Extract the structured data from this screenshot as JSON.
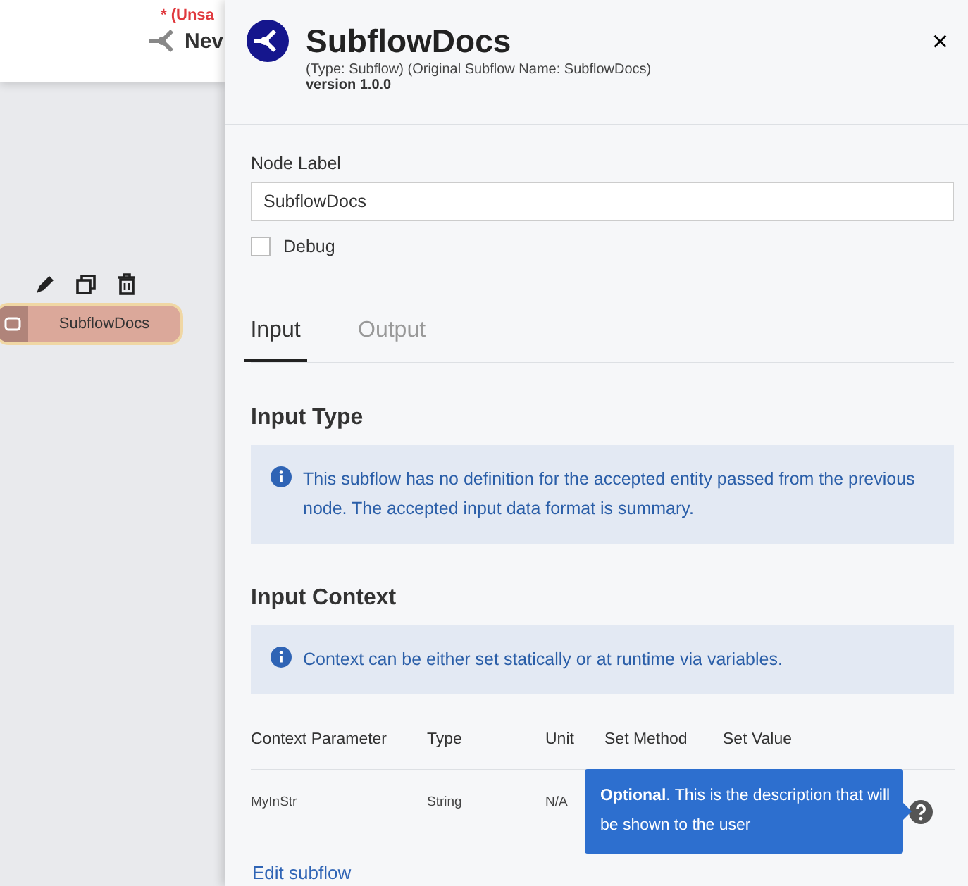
{
  "canvas": {
    "unsaved": "* (Unsa",
    "flow_name": "Nev",
    "node": {
      "label": "SubflowDocs",
      "selected": true
    }
  },
  "panel": {
    "title": "SubflowDocs",
    "subtitle": "(Type: Subflow) (Original Subflow Name: SubflowDocs)",
    "version": "version 1.0.0",
    "close": "×",
    "node_label": {
      "label": "Node Label",
      "value": "SubflowDocs"
    },
    "debug": {
      "label": "Debug",
      "checked": false
    },
    "tabs": [
      {
        "label": "Input",
        "selected": true
      },
      {
        "label": "Output",
        "selected": false
      }
    ],
    "input_type": {
      "heading": "Input Type",
      "note": "This subflow has no definition for the accepted entity passed from the previous node. The accepted input data format is summary."
    },
    "input_context": {
      "heading": "Input Context",
      "note": "Context can be either set statically or at runtime via variables."
    },
    "table": {
      "columns": [
        "Context Parameter",
        "Type",
        "Unit",
        "Set Method",
        "Set Value"
      ],
      "rows": [
        {
          "cells": [
            "MyInStr",
            "String",
            "N/A"
          ]
        }
      ]
    },
    "tooltip": "**Optional**. This is the description that will be shown to the user",
    "link": "Edit subflow"
  }
}
